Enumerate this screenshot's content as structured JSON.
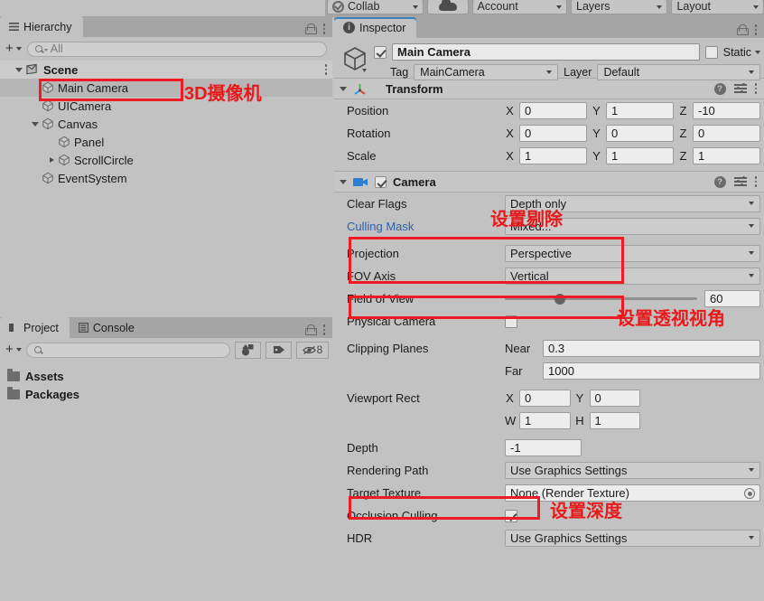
{
  "toolbar": {
    "collab": "Collab",
    "cloud_icon": "cloud-icon",
    "account": "Account",
    "layers": "Layers",
    "layout": "Layout"
  },
  "hierarchy": {
    "tab_label": "Hierarchy",
    "search_placeholder": "All",
    "scene_label": "Scene",
    "items": [
      {
        "label": "Main Camera",
        "indent": 1,
        "arrow": "none",
        "selected": true
      },
      {
        "label": "UICamera",
        "indent": 1,
        "arrow": "none",
        "selected": false
      },
      {
        "label": "Canvas",
        "indent": 1,
        "arrow": "down",
        "selected": false
      },
      {
        "label": "Panel",
        "indent": 2,
        "arrow": "none",
        "selected": false
      },
      {
        "label": "ScrollCircle",
        "indent": 2,
        "arrow": "right",
        "selected": false
      },
      {
        "label": "EventSystem",
        "indent": 1,
        "arrow": "none",
        "selected": false
      }
    ]
  },
  "project": {
    "tabs": [
      {
        "label": "Project",
        "active": true
      },
      {
        "label": "Console",
        "active": false
      }
    ],
    "search_placeholder": "",
    "hidden_count": "8",
    "folders": [
      "Assets",
      "Packages"
    ]
  },
  "inspector": {
    "tab_label": "Inspector",
    "object_name": "Main Camera",
    "object_enabled": true,
    "static_label": "Static",
    "static_checked": false,
    "tag_label": "Tag",
    "tag_value": "MainCamera",
    "layer_label": "Layer",
    "layer_value": "Default",
    "transform": {
      "title": "Transform",
      "rows": [
        {
          "label": "Position",
          "x": "0",
          "y": "1",
          "z": "-10"
        },
        {
          "label": "Rotation",
          "x": "0",
          "y": "0",
          "z": "0"
        },
        {
          "label": "Scale",
          "x": "1",
          "y": "1",
          "z": "1"
        }
      ]
    },
    "camera": {
      "title": "Camera",
      "enabled": true,
      "clear_flags_label": "Clear Flags",
      "clear_flags_value": "Depth only",
      "culling_mask_label": "Culling Mask",
      "culling_mask_value": "Mixed...",
      "projection_label": "Projection",
      "projection_value": "Perspective",
      "fov_axis_label": "FOV Axis",
      "fov_axis_value": "Vertical",
      "field_of_view_label": "Field of View",
      "field_of_view_value": "60",
      "physical_camera_label": "Physical Camera",
      "physical_camera_checked": false,
      "clipping_planes_label": "Clipping Planes",
      "near_label": "Near",
      "near_value": "0.3",
      "far_label": "Far",
      "far_value": "1000",
      "viewport_rect_label": "Viewport Rect",
      "vp_x_label": "X",
      "vp_x": "0",
      "vp_y_label": "Y",
      "vp_y": "0",
      "vp_w_label": "W",
      "vp_w": "1",
      "vp_h_label": "H",
      "vp_h": "1",
      "depth_label": "Depth",
      "depth_value": "-1",
      "rendering_path_label": "Rendering Path",
      "rendering_path_value": "Use Graphics Settings",
      "target_texture_label": "Target Texture",
      "target_texture_value": "None (Render Texture)",
      "occlusion_culling_label": "Occlusion Culling",
      "occlusion_culling_checked": true,
      "hdr_label": "HDR",
      "hdr_value": "Use Graphics Settings"
    }
  },
  "annotations": [
    {
      "text": "3D摄像机",
      "note": "3D Camera"
    },
    {
      "text": "设置剔除",
      "note": "Set Culling"
    },
    {
      "text": "设置透视视角",
      "note": "Set Perspective View"
    },
    {
      "text": "设置深度",
      "note": "Set Depth"
    }
  ],
  "colors": {
    "annotation_red": "#ed1c24",
    "panel_bg": "#c2c2c2",
    "toolbar_bg": "#a5a5a5",
    "blue_label": "#2c5fa8",
    "tab_accent": "#3d7ebd"
  }
}
